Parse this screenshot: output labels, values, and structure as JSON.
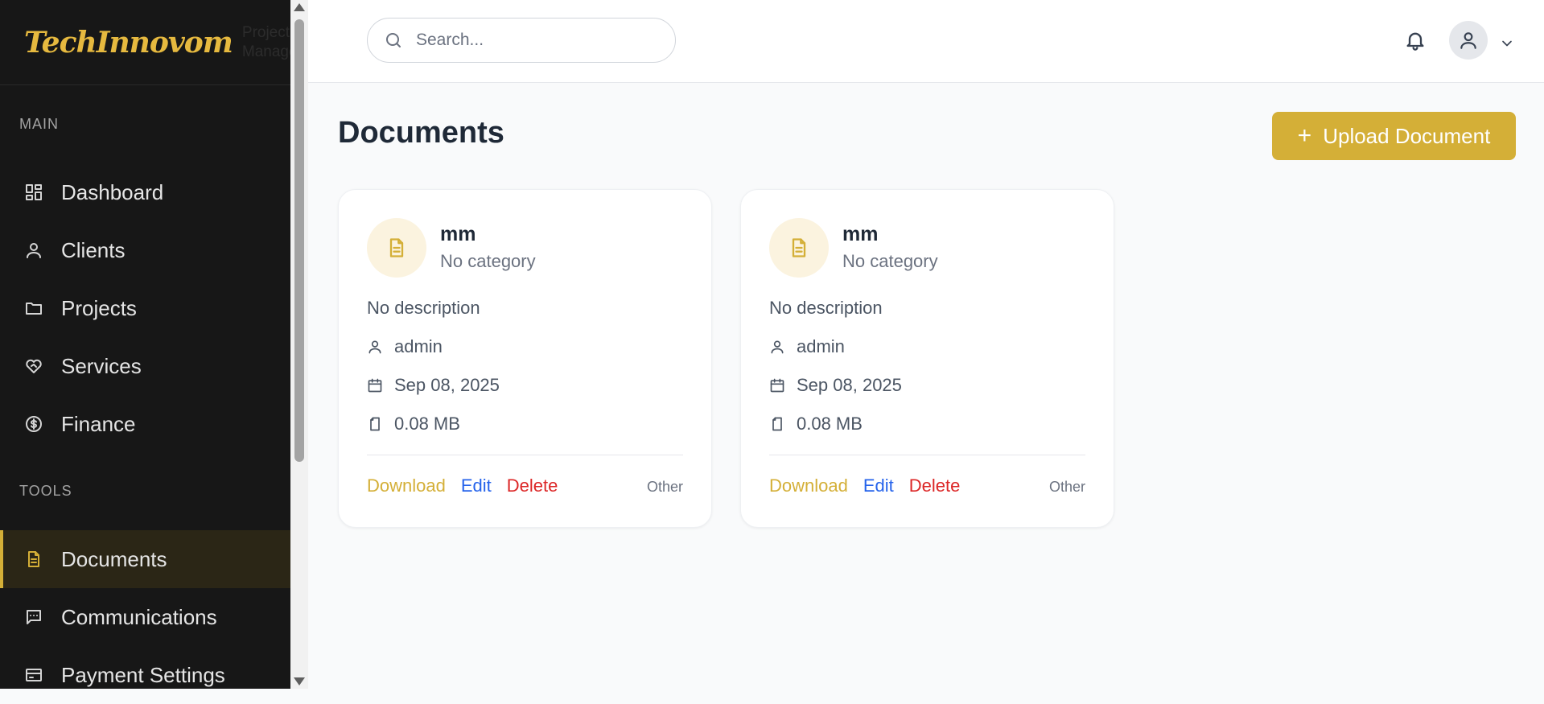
{
  "brand": {
    "logo": "TechInnovom",
    "subtitle": "Project Manager"
  },
  "sidebar": {
    "sections": [
      {
        "label": "MAIN",
        "items": [
          {
            "label": "Dashboard",
            "icon": "dashboard-icon"
          },
          {
            "label": "Clients",
            "icon": "user-icon"
          },
          {
            "label": "Projects",
            "icon": "folder-icon"
          },
          {
            "label": "Services",
            "icon": "heart-handshake-icon"
          },
          {
            "label": "Finance",
            "icon": "dollar-circle-icon"
          }
        ]
      },
      {
        "label": "TOOLS",
        "items": [
          {
            "label": "Documents",
            "icon": "document-icon",
            "active": true
          },
          {
            "label": "Communications",
            "icon": "message-icon"
          },
          {
            "label": "Payment Settings",
            "icon": "card-icon"
          }
        ]
      }
    ]
  },
  "header": {
    "search_placeholder": "Search..."
  },
  "main": {
    "title": "Documents",
    "upload_button": {
      "icon": "+",
      "label": "Upload Document"
    }
  },
  "documents": [
    {
      "title": "mm",
      "category": "No category",
      "description": "No description",
      "owner": "admin",
      "date": "Sep 08, 2025",
      "size": "0.08 MB",
      "type": "Other",
      "actions": {
        "download": "Download",
        "edit": "Edit",
        "delete": "Delete"
      }
    },
    {
      "title": "mm",
      "category": "No category",
      "description": "No description",
      "owner": "admin",
      "date": "Sep 08, 2025",
      "size": "0.08 MB",
      "type": "Other",
      "actions": {
        "download": "Download",
        "edit": "Edit",
        "delete": "Delete"
      }
    }
  ],
  "colors": {
    "accent": "#d4af37",
    "sidebar_bg": "#171717",
    "edit": "#2563eb",
    "delete": "#dc2626"
  }
}
